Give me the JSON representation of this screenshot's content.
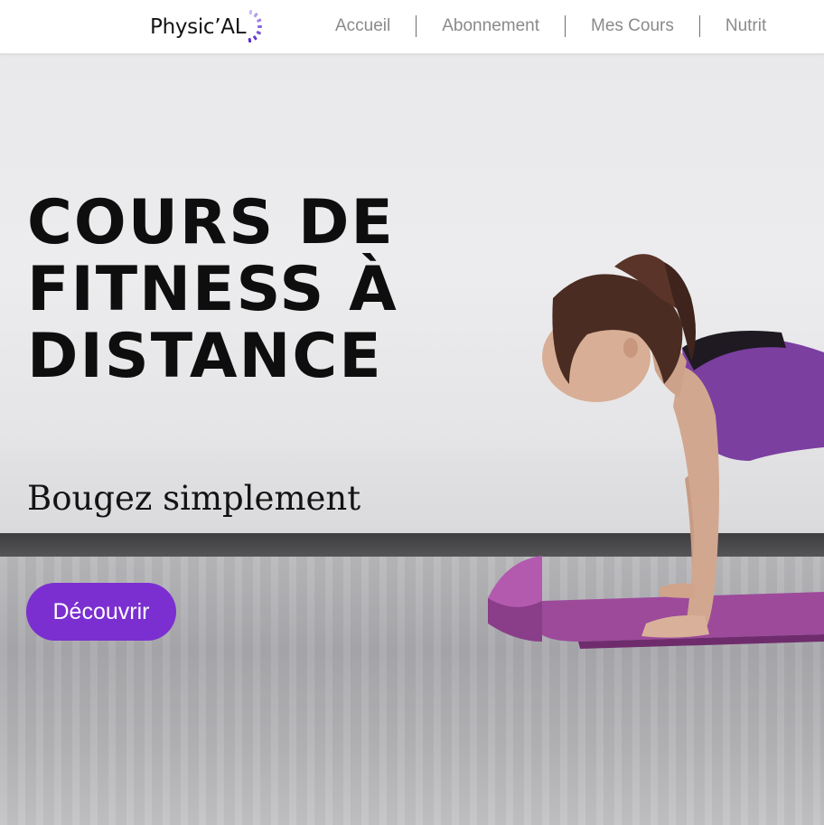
{
  "brand": {
    "name": "Physic’AL",
    "accent_color": "#7b2fd0",
    "logo_icon": "dotted-ring-icon"
  },
  "nav": {
    "items": [
      {
        "label": "Accueil"
      },
      {
        "label": "Abonnement"
      },
      {
        "label": "Mes Cours"
      },
      {
        "label": "Nutrit"
      }
    ]
  },
  "hero": {
    "title": "COURS DE\nFITNESS À\nDISTANCE",
    "subtitle": "Bougez simplement",
    "cta_label": "Découvrir",
    "image": "woman-on-yoga-mat-photo"
  }
}
